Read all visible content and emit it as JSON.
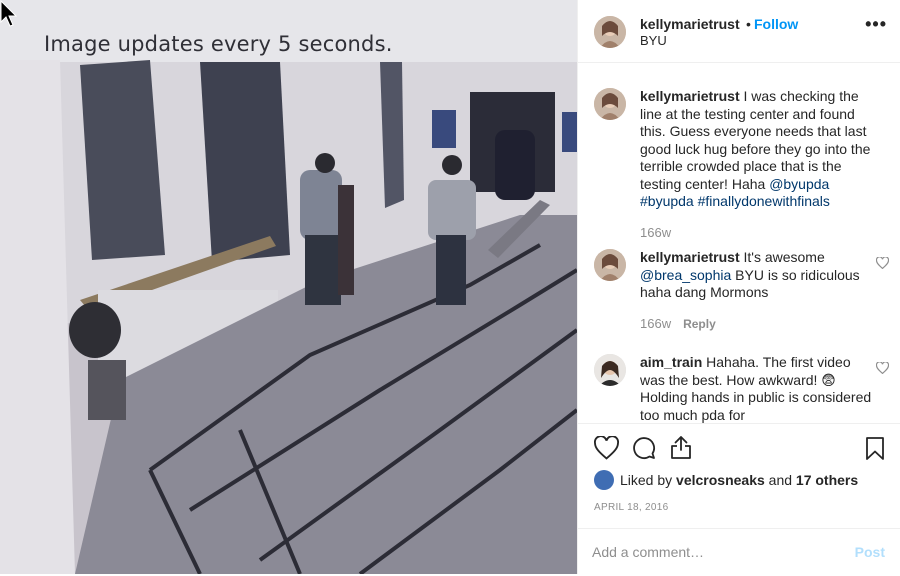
{
  "photo": {
    "caption": "Image updates every 5 seconds."
  },
  "header": {
    "username": "kellymarietrust",
    "dot": "•",
    "follow_label": "Follow",
    "location": "BYU",
    "more_icon": "ellipsis-icon"
  },
  "comments": [
    {
      "username": "kellymarietrust",
      "text": "I was checking the line at the testing center and found this. Guess everyone needs that last good luck hug before they go into the terrible crowded place that is the testing center! Haha",
      "tag1": "@byupda",
      "tag2": "#byupda",
      "tag3": "#finallydonewithfinals",
      "time": "166w"
    },
    {
      "username": "kellymarietrust",
      "text_before": "It's awesome",
      "mention": "@brea_sophia",
      "text_after": "BYU is so ridiculous haha dang Mormons",
      "time": "166w",
      "reply_label": "Reply"
    },
    {
      "username": "aim_train",
      "text": "Hahaha. The first video was the best. How awkward! 😨 Holding hands in public is considered too much pda for"
    }
  ],
  "actions": {
    "icons": [
      "heart-icon",
      "comment-icon",
      "share-icon",
      "bookmark-icon"
    ],
    "liked_by_prefix": "Liked by",
    "liked_by_user": "velcrosneaks",
    "liked_by_and": "and",
    "liked_by_others": "17 others",
    "date": "APRIL 18, 2016",
    "add_comment_placeholder": "Add a comment…",
    "post_label": "Post"
  },
  "colors": {
    "link_blue": "#0095f6",
    "hashtag": "#00376b",
    "muted": "#8e8e8e",
    "post_disabled": "#b2dffc"
  }
}
